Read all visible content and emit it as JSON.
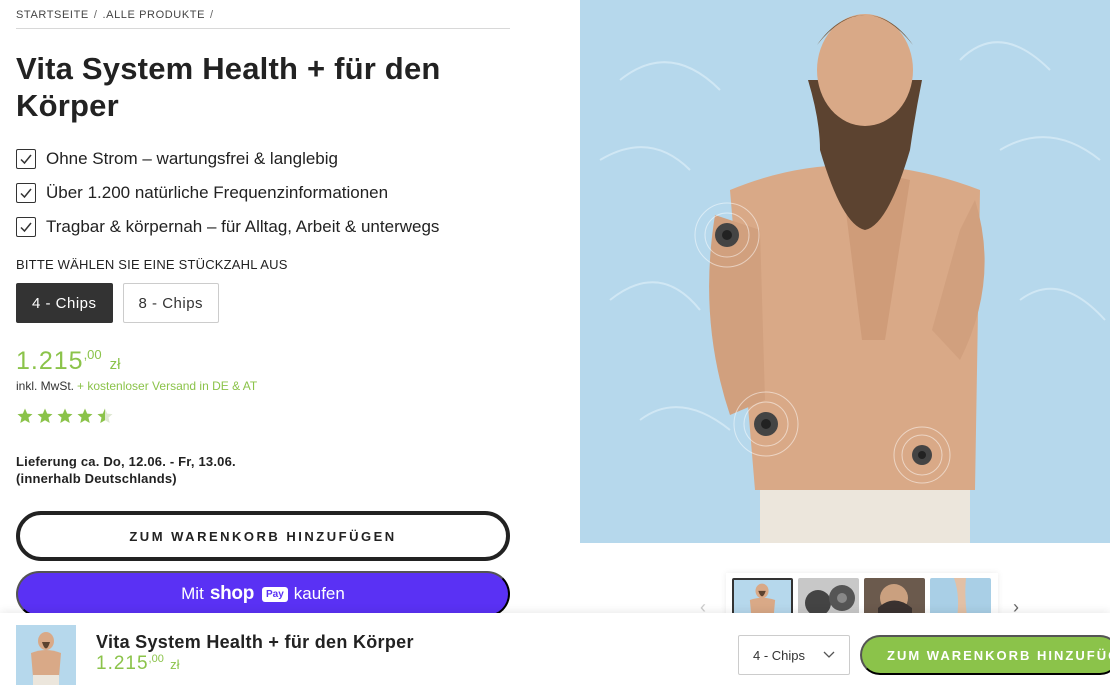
{
  "breadcrumb": {
    "items": [
      "STARTSEITE",
      ".ALLE PRODUKTE"
    ],
    "sep": "/"
  },
  "product": {
    "title": "Vita System Health + für den Körper",
    "features": [
      "Ohne Strom – wartungsfrei & langlebig",
      "Über 1.200 natürliche Frequenzinformationen",
      "Tragbar & körpernah – für Alltag, Arbeit & unterwegs"
    ],
    "quantity_label": "BITTE WÄHLEN SIE EINE STÜCKZAHL AUS",
    "quantity_options": [
      "4 - Chips",
      "8 - Chips"
    ],
    "selected_option": "4 - Chips",
    "price": {
      "main": "1.215",
      "cents": ",00",
      "currency": "zł"
    },
    "tax_note": "inkl. MwSt.",
    "shipping_note": "+ kostenloser Versand in DE & AT",
    "rating": 4.5,
    "delivery_line1": "Lieferung ca. Do, 12.06. - Fr, 13.06.",
    "delivery_line2": "(innerhalb Deutschlands)",
    "add_to_cart": "ZUM WARENKORB HINZUFÜGEN",
    "shoppay": {
      "prefix": "Mit",
      "brand": "shop",
      "badge": "Pay",
      "suffix": "kaufen"
    }
  },
  "gallery": {
    "thumb_count": 4,
    "active_index": 0
  },
  "sticky_bar": {
    "title": "Vita System Health + für den Körper",
    "price": {
      "main": "1.215",
      "cents": ",00",
      "currency": "zł"
    },
    "selected_option": "4 - Chips",
    "add_to_cart": "ZUM WARENKORB HINZUFÜGEN"
  },
  "colors": {
    "accent_green": "#8bc34a",
    "shoppay_purple": "#5a31f4",
    "dark": "#333333"
  }
}
